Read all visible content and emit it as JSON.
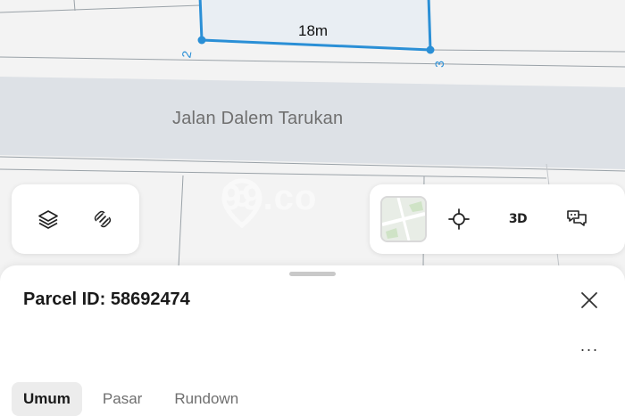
{
  "map": {
    "road_name": "Jalan Dalem Tarukan",
    "parcel_side_length": "18m",
    "vertex_labels": [
      "2",
      "3"
    ],
    "watermark": "99.co",
    "colors": {
      "parcel_outline": "#2a8fd6",
      "parcel_fill": "#e9eef3",
      "road": "#dde1e6",
      "background": "#f3f3f3"
    }
  },
  "map_tools": {
    "layers_icon": "layers-icon",
    "measure_icon": "measure-icon",
    "basemap_icon": "basemap-thumbnail-icon",
    "locate_icon": "locate-crosshair-icon",
    "view3d_label": "3D",
    "feedback_icon": "feedback-chat-icon"
  },
  "sheet": {
    "title": "Parcel ID: 58692474",
    "more_label": "···",
    "tabs": [
      {
        "label": "Umum",
        "active": true
      },
      {
        "label": "Pasar",
        "active": false
      },
      {
        "label": "Rundown",
        "active": false
      }
    ]
  }
}
